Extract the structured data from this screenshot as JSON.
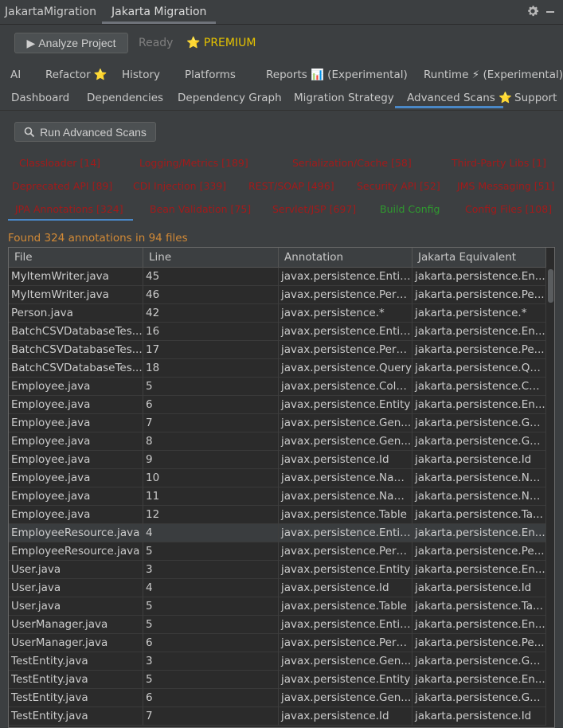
{
  "toolwindow": {
    "title": "JakartaMigration",
    "tab": "Jakarta Migration"
  },
  "toolbar": {
    "analyze_label": "Analyze Project",
    "analyze_icon": "▶",
    "status": "Ready",
    "premium": "⭐ PREMIUM"
  },
  "tabs_row1": [
    "AI",
    "Refactor ⭐",
    "History",
    "Platforms",
    "Reports 📊 (Experimental)",
    "Runtime ⚡ (Experimental)"
  ],
  "tabs_row2": [
    "Dashboard",
    "Dependencies",
    "Dependency Graph",
    "Migration Strategy",
    "Advanced Scans ⭐",
    "Support"
  ],
  "active_tab": "Advanced Scans ⭐",
  "run_scans_label": "Run Advanced Scans",
  "scan_categories": [
    "Classloader [14]",
    "Logging/Metrics [189]",
    "Serialization/Cache [58]",
    "Third-Party Libs [1]",
    "Deprecated API [89]",
    "CDI Injection [339]",
    "REST/SOAP [496]",
    "Security API [52]",
    "JMS Messaging [51]",
    "JPA Annotations [324]",
    "Bean Validation [75]",
    "Servlet/JSP [697]",
    "Build Config",
    "Config Files [108]"
  ],
  "colors": {
    "scan_error": "#a31a1a",
    "scan_ok": "#2f9a2f",
    "found": "#d28a36",
    "accent": "#4a88c7",
    "premium": "#e5c200"
  },
  "found_text": "Found 324 annotations in 94 files",
  "table": {
    "columns": [
      "File",
      "Line",
      "Annotation",
      "Jakarta Equivalent"
    ],
    "rows": [
      [
        "MyItemWriter.java",
        "45",
        "javax.persistence.Entit...",
        "jakarta.persistence.En..."
      ],
      [
        "MyItemWriter.java",
        "46",
        "javax.persistence.Pers...",
        "jakarta.persistence.Pe..."
      ],
      [
        "Person.java",
        "42",
        "javax.persistence.*",
        "jakarta.persistence.*"
      ],
      [
        "BatchCSVDatabaseTes...",
        "16",
        "javax.persistence.Entit...",
        "jakarta.persistence.En..."
      ],
      [
        "BatchCSVDatabaseTes...",
        "17",
        "javax.persistence.Pers...",
        "jakarta.persistence.Pe..."
      ],
      [
        "BatchCSVDatabaseTes...",
        "18",
        "javax.persistence.Query",
        "jakarta.persistence.Qu..."
      ],
      [
        "Employee.java",
        "5",
        "javax.persistence.Colu...",
        "jakarta.persistence.Co..."
      ],
      [
        "Employee.java",
        "6",
        "javax.persistence.Entity",
        "jakarta.persistence.En..."
      ],
      [
        "Employee.java",
        "7",
        "javax.persistence.Gen...",
        "jakarta.persistence.Ge..."
      ],
      [
        "Employee.java",
        "8",
        "javax.persistence.Gen...",
        "jakarta.persistence.Ge..."
      ],
      [
        "Employee.java",
        "9",
        "javax.persistence.Id",
        "jakarta.persistence.Id"
      ],
      [
        "Employee.java",
        "10",
        "javax.persistence.Nam...",
        "jakarta.persistence.Na..."
      ],
      [
        "Employee.java",
        "11",
        "javax.persistence.Nam...",
        "jakarta.persistence.Na..."
      ],
      [
        "Employee.java",
        "12",
        "javax.persistence.Table",
        "jakarta.persistence.Ta..."
      ],
      [
        "EmployeeResource.java",
        "4",
        "javax.persistence.Entit...",
        "jakarta.persistence.En..."
      ],
      [
        "EmployeeResource.java",
        "5",
        "javax.persistence.Pers...",
        "jakarta.persistence.Pe..."
      ],
      [
        "User.java",
        "3",
        "javax.persistence.Entity",
        "jakarta.persistence.En..."
      ],
      [
        "User.java",
        "4",
        "javax.persistence.Id",
        "jakarta.persistence.Id"
      ],
      [
        "User.java",
        "5",
        "javax.persistence.Table",
        "jakarta.persistence.Ta..."
      ],
      [
        "UserManager.java",
        "5",
        "javax.persistence.Entit...",
        "jakarta.persistence.En..."
      ],
      [
        "UserManager.java",
        "6",
        "javax.persistence.Pers...",
        "jakarta.persistence.Pe..."
      ],
      [
        "TestEntity.java",
        "3",
        "javax.persistence.Gen...",
        "jakarta.persistence.Ge..."
      ],
      [
        "TestEntity.java",
        "5",
        "javax.persistence.Entity",
        "jakarta.persistence.En..."
      ],
      [
        "TestEntity.java",
        "6",
        "javax.persistence.Gen...",
        "jakarta.persistence.Ge..."
      ],
      [
        "TestEntity.java",
        "7",
        "javax.persistence.Id",
        "jakarta.persistence.Id"
      ]
    ]
  }
}
